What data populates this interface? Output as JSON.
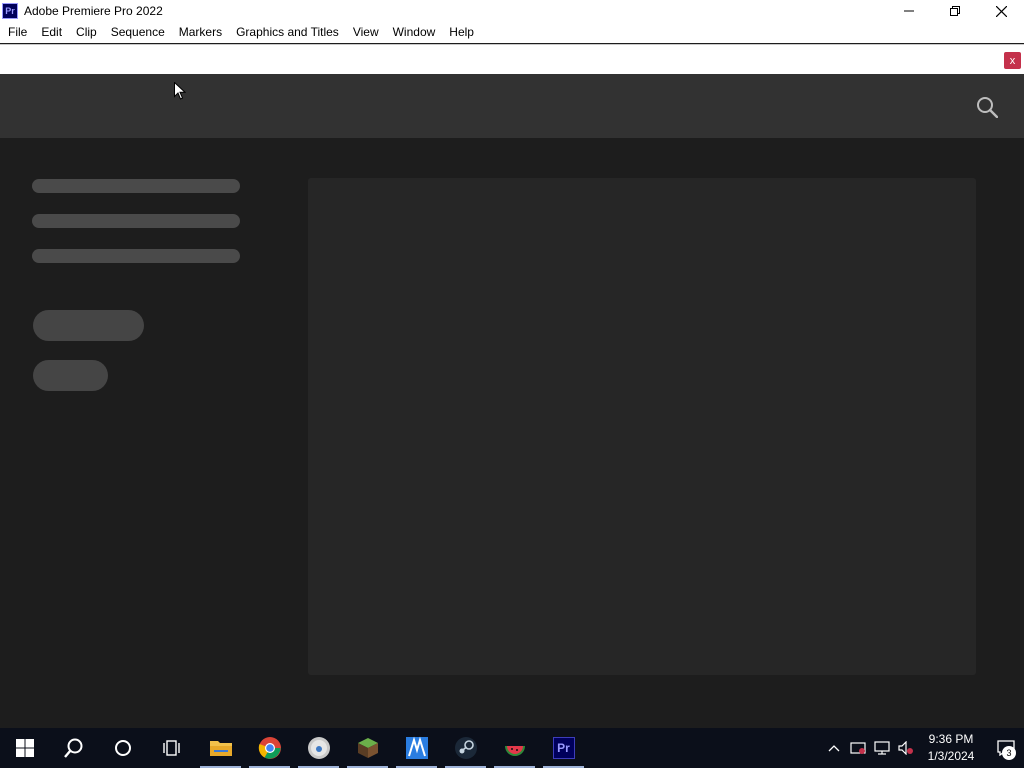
{
  "window": {
    "app_icon_label": "Pr",
    "title": "Adobe Premiere Pro 2022",
    "controls": {
      "minimize": "minimize-icon",
      "restore": "restore-icon",
      "close": "close-icon"
    }
  },
  "menu": {
    "items": [
      "File",
      "Edit",
      "Clip",
      "Sequence",
      "Markers",
      "Graphics and Titles",
      "View",
      "Window",
      "Help"
    ]
  },
  "notification": {
    "close_label": "x"
  },
  "home": {
    "search_icon": "search-icon"
  },
  "taskbar": {
    "apps": [
      {
        "name": "start",
        "icon": "windows-start-icon"
      },
      {
        "name": "search",
        "icon": "search-icon"
      },
      {
        "name": "cortana",
        "icon": "cortana-icon"
      },
      {
        "name": "task-view",
        "icon": "task-view-icon"
      },
      {
        "name": "file-explorer",
        "icon": "folder-icon"
      },
      {
        "name": "chrome",
        "icon": "chrome-icon"
      },
      {
        "name": "app-globe",
        "icon": "globe-app-icon"
      },
      {
        "name": "minecraft",
        "icon": "minecraft-icon"
      },
      {
        "name": "app-blue",
        "icon": "blue-app-icon"
      },
      {
        "name": "steam",
        "icon": "steam-icon"
      },
      {
        "name": "app-melon",
        "icon": "melon-app-icon"
      },
      {
        "name": "premiere",
        "icon": "premiere-icon",
        "label": "Pr"
      }
    ],
    "clock": {
      "time": "9:36 PM",
      "date": "1/3/2024"
    },
    "notification_count": "3"
  },
  "colors": {
    "premiere_bg": "#00005b",
    "premiere_fg": "#9999ff",
    "close_red": "#c4314b",
    "header": "#323232",
    "panel": "#262626"
  }
}
